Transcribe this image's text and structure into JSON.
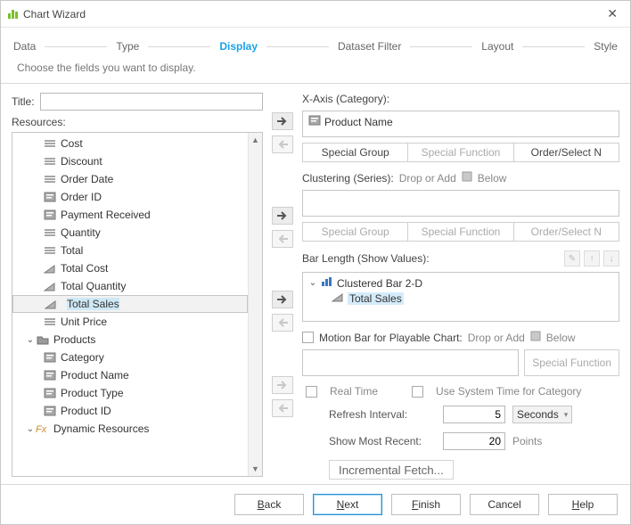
{
  "titlebar": {
    "title": "Chart Wizard"
  },
  "steps": [
    "Data",
    "Type",
    "Display",
    "Dataset Filter",
    "Layout",
    "Style"
  ],
  "active_step_index": 2,
  "hint": "Choose the fields you want to display.",
  "left": {
    "title_label": "Title:",
    "title_value": "",
    "resources_label": "Resources:",
    "tree": [
      {
        "label": "Cost",
        "icon": "num",
        "indent": 1
      },
      {
        "label": "Discount",
        "icon": "num",
        "indent": 1
      },
      {
        "label": "Order Date",
        "icon": "num",
        "indent": 1
      },
      {
        "label": "Order ID",
        "icon": "txt",
        "indent": 1
      },
      {
        "label": "Payment Received",
        "icon": "txt",
        "indent": 1
      },
      {
        "label": "Quantity",
        "icon": "num",
        "indent": 1
      },
      {
        "label": "Total",
        "icon": "num",
        "indent": 1
      },
      {
        "label": "Total Cost",
        "icon": "wedge",
        "indent": 1
      },
      {
        "label": "Total Quantity",
        "icon": "wedge",
        "indent": 1
      },
      {
        "label": "Total Sales",
        "icon": "wedge",
        "indent": 1,
        "selected": true
      },
      {
        "label": "Unit Price",
        "icon": "num",
        "indent": 1
      },
      {
        "label": "Products",
        "icon": "folder",
        "indent": 0,
        "expander": "v"
      },
      {
        "label": "Category",
        "icon": "txt",
        "indent": 1
      },
      {
        "label": "Product Name",
        "icon": "txt",
        "indent": 1
      },
      {
        "label": "Product Type",
        "icon": "txt",
        "indent": 1
      },
      {
        "label": "Product ID",
        "icon": "txt",
        "indent": 1
      },
      {
        "label": "Dynamic Resources",
        "icon": "fx",
        "indent": 0,
        "expander": "v"
      }
    ]
  },
  "xaxis": {
    "label": "X-Axis (Category):",
    "item": "Product Name",
    "btns": {
      "special_group": "Special Group",
      "special_func": "Special Function",
      "order": "Order/Select N"
    }
  },
  "cluster": {
    "label": "Clustering (Series):",
    "sub1": "Drop or Add",
    "sub2": "Below",
    "btns": {
      "special_group": "Special Group",
      "special_func": "Special Function",
      "order": "Order/Select N"
    }
  },
  "barlen": {
    "label": "Bar Length (Show Values):",
    "group": "Clustered Bar 2-D",
    "item": "Total Sales"
  },
  "motion": {
    "label": "Motion Bar for Playable Chart:",
    "sub1": "Drop or Add",
    "sub2": "Below",
    "special_func": "Special Function",
    "realtime": "Real Time",
    "use_system_time": "Use System Time for Category",
    "refresh_label": "Refresh Interval:",
    "refresh_value": "5",
    "refresh_unit": "Seconds",
    "recent_label": "Show Most Recent:",
    "recent_value": "20",
    "recent_unit": "Points",
    "incremental": "Incremental Fetch..."
  },
  "footer": {
    "back": "ack",
    "next": "ext",
    "finish": "inish",
    "cancel": "Cancel",
    "help": "elp",
    "backU": "B",
    "nextU": "N",
    "finishU": "F",
    "helpU": "H"
  }
}
